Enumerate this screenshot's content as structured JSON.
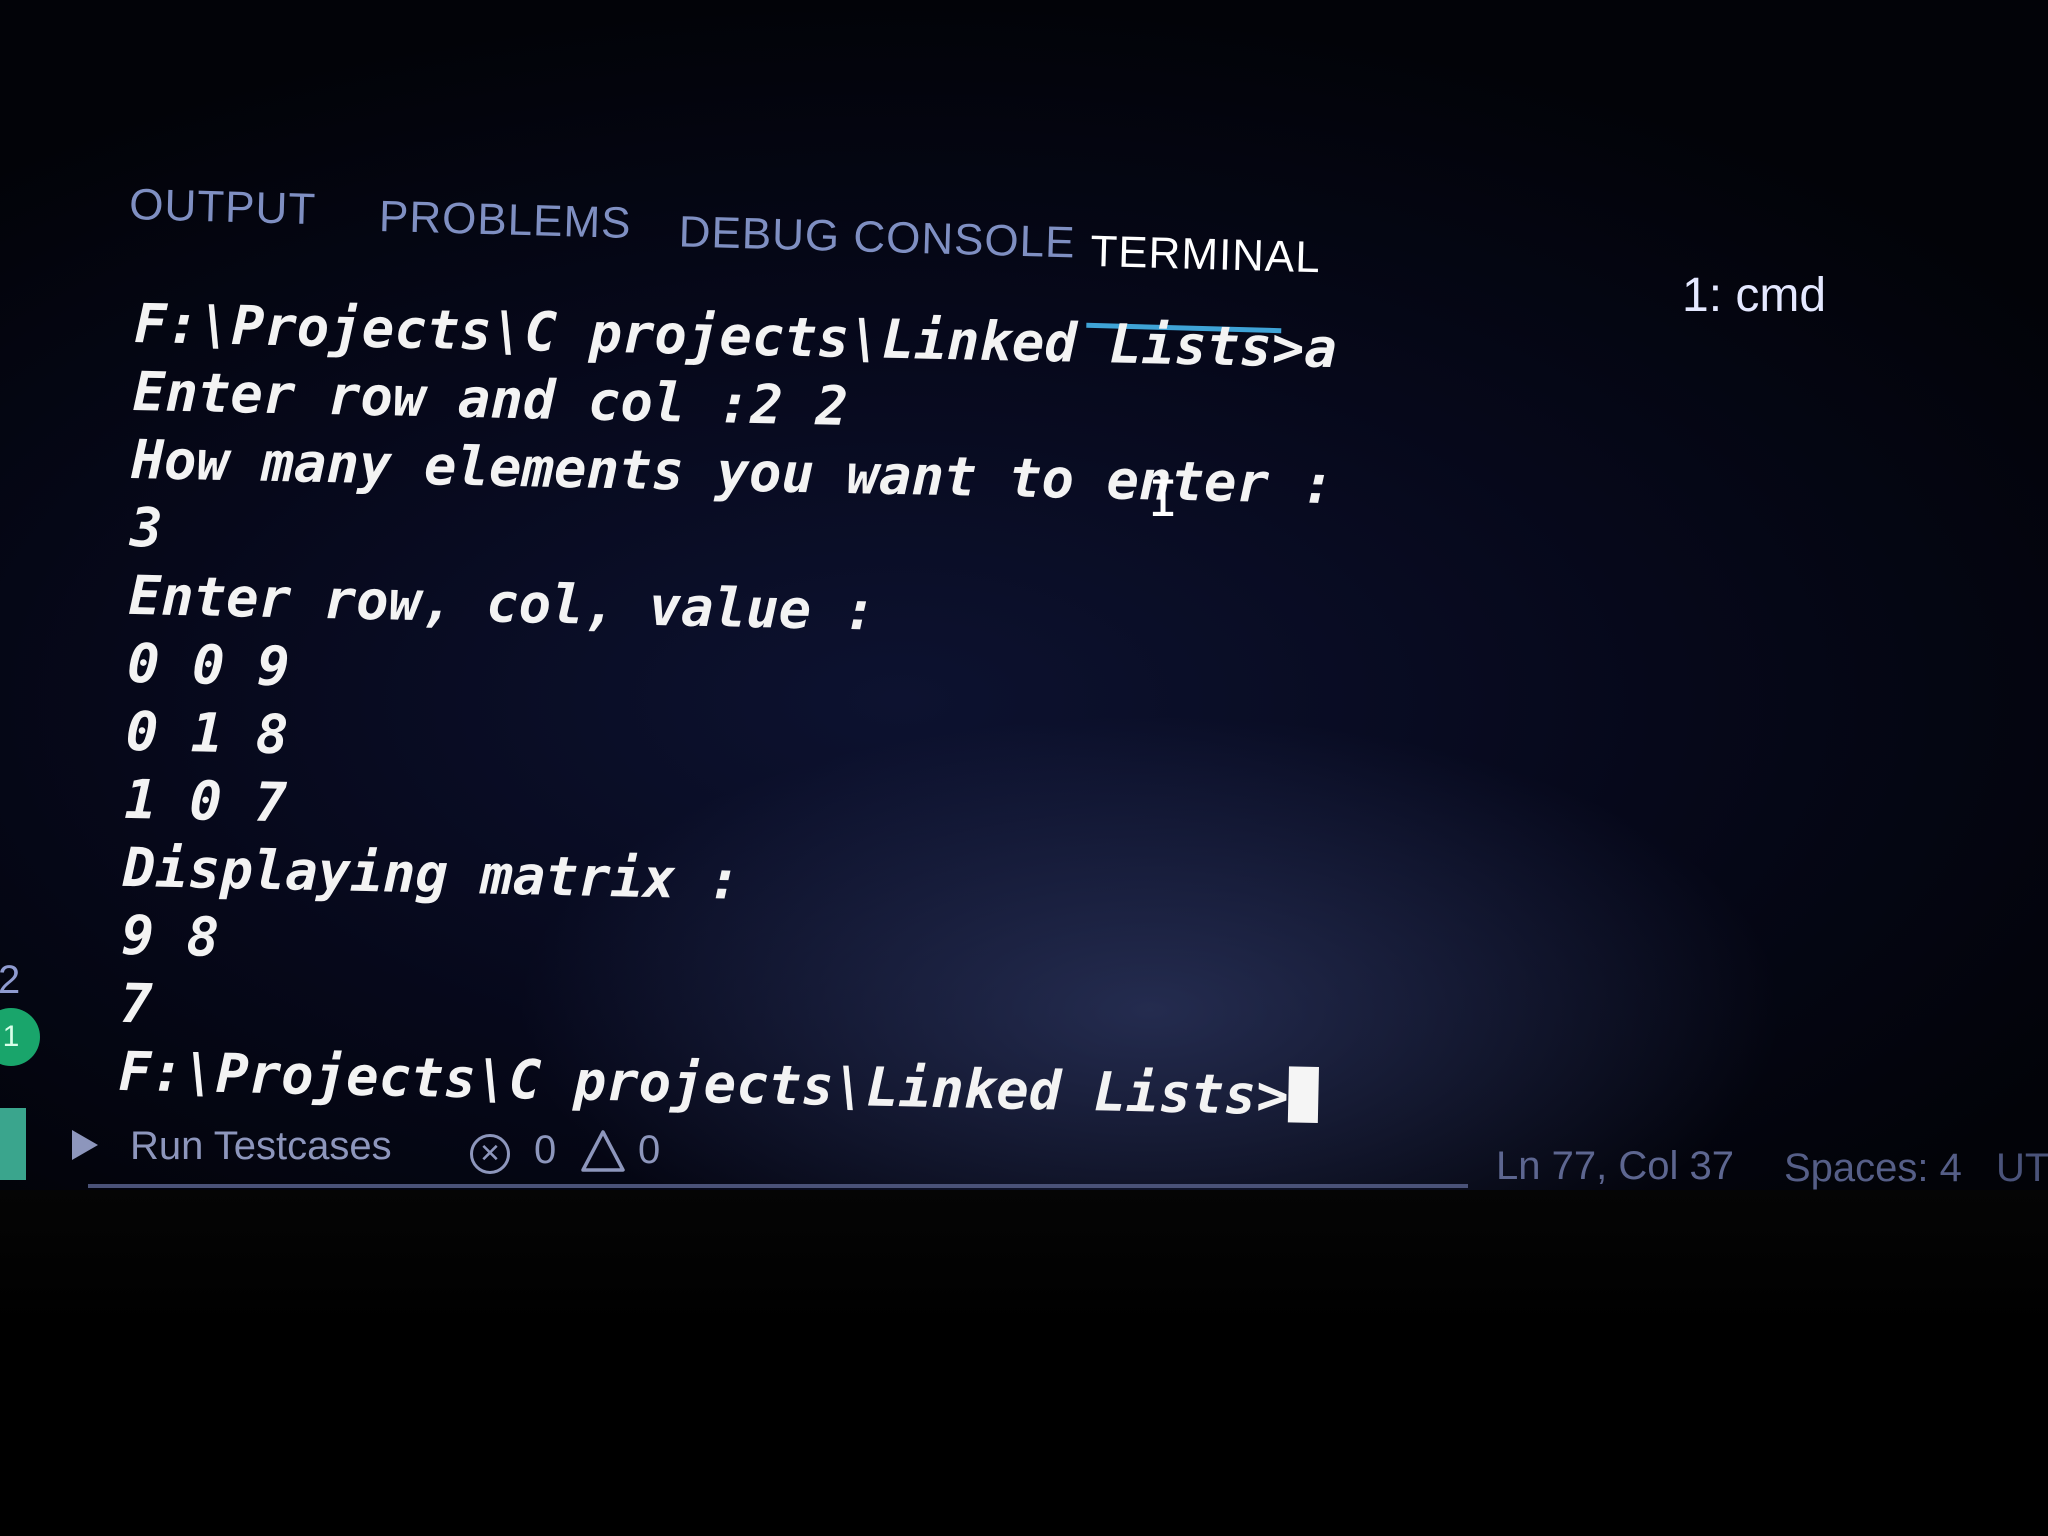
{
  "tabs": [
    {
      "label": "OUTPUT",
      "active": false
    },
    {
      "label": "PROBLEMS",
      "active": false
    },
    {
      "label": "DEBUG CONSOLE",
      "active": false
    },
    {
      "label": "TERMINAL",
      "active": true
    }
  ],
  "terminal_selector": "1: cmd",
  "terminal": {
    "lines": [
      "F:\\Projects\\C projects\\Linked Lists>a",
      "Enter row and col :2 2",
      "How many elements you want to enter :",
      "3",
      "Enter row, col, value :",
      "0 0 9",
      "0 1 8",
      "1 0 7",
      "Displaying matrix :",
      "9 8",
      "7"
    ],
    "prompt": "F:\\Projects\\C projects\\Linked Lists>"
  },
  "activity": {
    "count_above": "2",
    "badge_count": "1"
  },
  "status_bar": {
    "run_label": "Run Testcases",
    "errors": "0",
    "warnings": "0",
    "cursor_position": "Ln 77, Col 37",
    "indentation": "Spaces: 4",
    "encoding": "UTF"
  },
  "colors": {
    "tab_inactive": "#7f8fc2",
    "tab_active": "#ffffff",
    "tab_underline": "#3fa3d6",
    "terminal_text": "#f3f3f3",
    "badge": "#19a56b"
  }
}
